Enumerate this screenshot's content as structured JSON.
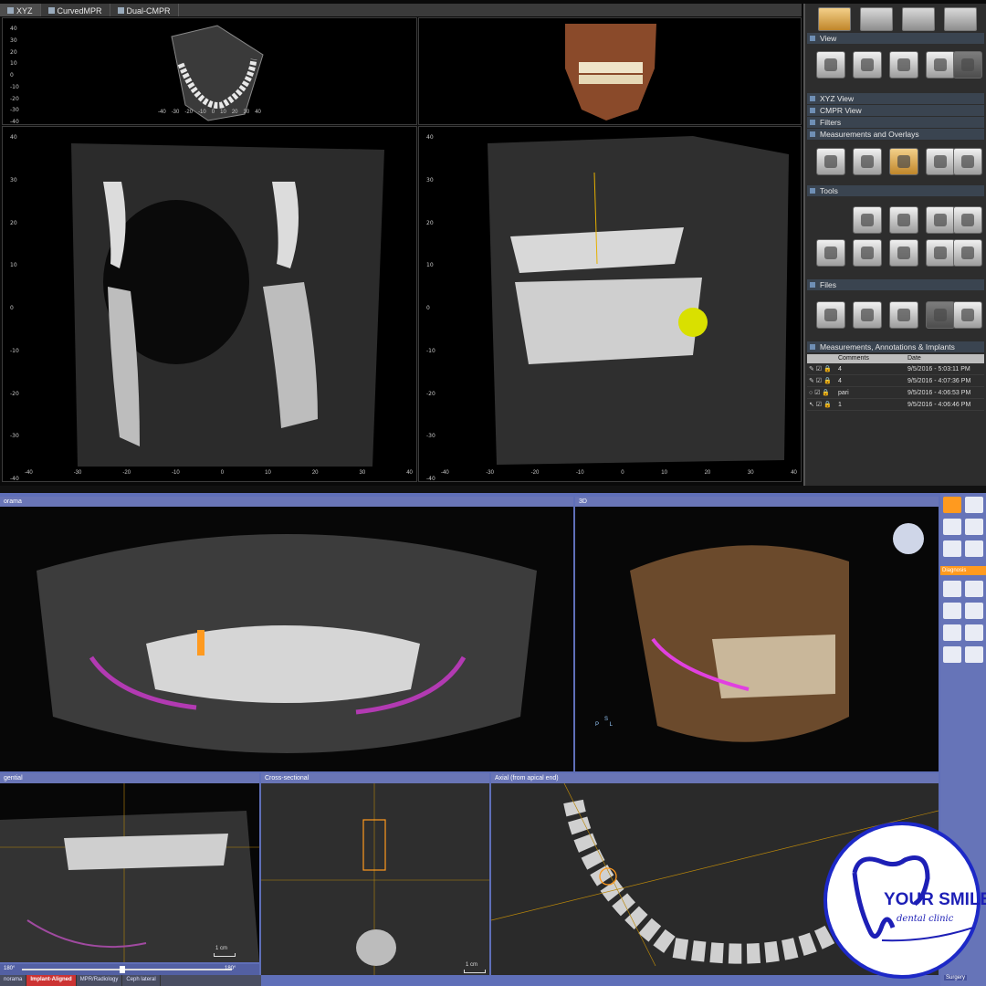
{
  "top_app": {
    "tabs": [
      {
        "label": "XYZ",
        "active": true
      },
      {
        "label": "CurvedMPR",
        "active": false
      },
      {
        "label": "Dual-CMPR",
        "active": false
      }
    ],
    "axial_ruler_v": [
      "40",
      "30",
      "20",
      "10",
      "0",
      "-10",
      "-20",
      "-30",
      "-40"
    ],
    "axial_ruler_h": [
      "-40",
      "-30",
      "-20",
      "-10",
      "0",
      "10",
      "20",
      "30",
      "40"
    ],
    "coronal_ruler_v": [
      "40",
      "30",
      "20",
      "10",
      "0",
      "-10",
      "-20",
      "-30",
      "-40"
    ],
    "coronal_ruler_h": [
      "-40",
      "-30",
      "-20",
      "-10",
      "0",
      "10",
      "20",
      "30",
      "40"
    ],
    "sagittal_ruler_v": [
      "40",
      "30",
      "20",
      "10",
      "0",
      "-10",
      "-20",
      "-30",
      "-40"
    ],
    "sagittal_ruler_h": [
      "-40",
      "-30",
      "-20",
      "-10",
      "0",
      "10",
      "20",
      "30",
      "40"
    ],
    "panel": {
      "view_section": "View",
      "sections": [
        "XYZ View",
        "CMPR View",
        "Filters",
        "Measurements and Overlays"
      ],
      "tools_section": "Tools",
      "files_section": "Files",
      "list_section": "Measurements, Annotations & Implants",
      "table": {
        "headers": [
          "Comments",
          "Date"
        ],
        "rows": [
          {
            "comment": "4",
            "date": "9/5/2016 - 5:03:11 PM"
          },
          {
            "comment": "4",
            "date": "9/5/2016 - 4:07:36 PM"
          },
          {
            "comment": "pari",
            "date": "9/5/2016 - 4:06:53 PM"
          },
          {
            "comment": "1",
            "date": "9/5/2016 - 4:06:46 PM"
          }
        ]
      }
    }
  },
  "bottom_app": {
    "panorama_header": "orama",
    "view3d_header": "3D",
    "tangential_header": "gential",
    "cross_header": "Cross-sectional",
    "axial_header": "Axial (from apical end)",
    "diagnosis_label": "Diagnosis",
    "surgery_label": "Surgery",
    "orientation": {
      "s": "S",
      "p": "P",
      "l": "L"
    },
    "scale_label": "1 cm",
    "slider_min": "180°",
    "slider_max": "180°",
    "tabs": [
      {
        "label": "norama",
        "active": false
      },
      {
        "label": "Implant-Aligned",
        "active": true
      },
      {
        "label": "MPR/Radiology",
        "active": false
      },
      {
        "label": "Ceph lateral",
        "active": false
      }
    ]
  },
  "logo": {
    "title": "YOUR SMILE",
    "subtitle": "dental clinic",
    "color": "#1d1fb6"
  },
  "colors": {
    "accent_orange": "#ff9a1f",
    "canal_magenta": "#c03ac0",
    "marker_yellow": "#d9e000",
    "panel_blue": "#5f6fb8"
  }
}
